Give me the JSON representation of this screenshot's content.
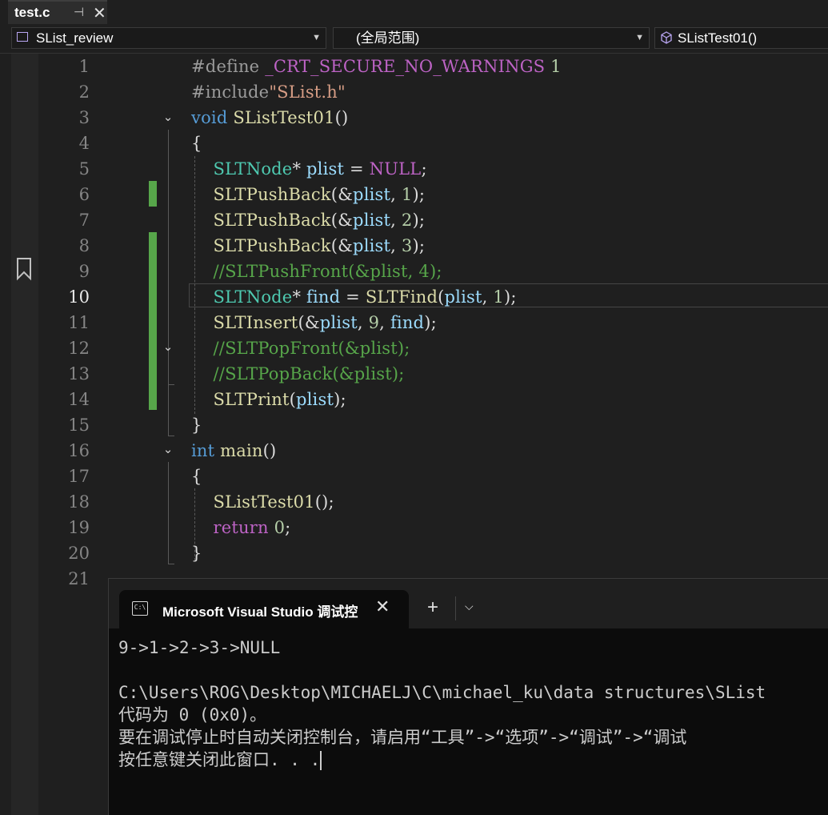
{
  "tab": {
    "title": "test.c"
  },
  "nav": {
    "project": "SList_review",
    "scope": "(全局范围)",
    "member": "SListTest01()"
  },
  "code_lines": [
    {
      "ln": "1"
    },
    {
      "ln": "2"
    },
    {
      "ln": "3"
    },
    {
      "ln": "4"
    },
    {
      "ln": "5"
    },
    {
      "ln": "6"
    },
    {
      "ln": "7"
    },
    {
      "ln": "8"
    },
    {
      "ln": "9"
    },
    {
      "ln": "10"
    },
    {
      "ln": "11"
    },
    {
      "ln": "12"
    },
    {
      "ln": "13"
    },
    {
      "ln": "14"
    },
    {
      "ln": "15"
    },
    {
      "ln": "16"
    },
    {
      "ln": "17"
    },
    {
      "ln": "18"
    },
    {
      "ln": "19"
    },
    {
      "ln": "20"
    },
    {
      "ln": "21"
    }
  ],
  "code": {
    "l1": {
      "kw": "#define",
      "name": "_CRT_SECURE_NO_WARNINGS",
      "val": "1"
    },
    "l2": {
      "kw": "#include",
      "str": "\"SList.h\""
    },
    "l3": {
      "kw": "void",
      "fn": "SListTest01",
      "rest": "()"
    },
    "l4": {
      "text": "{"
    },
    "l5": {
      "type": "SLTNode",
      "op": "*",
      "var": "plist",
      "eq": " = ",
      "val": "NULL",
      "end": ";"
    },
    "l6": {
      "fn": "SLTPushBack",
      "a": "(&",
      "var": "plist",
      "b": ", ",
      "n": "1",
      "c": ");"
    },
    "l7": {
      "fn": "SLTPushBack",
      "a": "(&",
      "var": "plist",
      "b": ", ",
      "n": "2",
      "c": ");"
    },
    "l8": {
      "fn": "SLTPushBack",
      "a": "(&",
      "var": "plist",
      "b": ", ",
      "n": "3",
      "c": ");"
    },
    "l9": {
      "comment": "//SLTPushFront(&plist, 4);"
    },
    "l10": {
      "type": "SLTNode",
      "op": "*",
      "var": "find",
      "eq": " = ",
      "fn": "SLTFind",
      "a": "(",
      "var2": "plist",
      "b": ", ",
      "n": "1",
      "c": ");"
    },
    "l11": {
      "fn": "SLTInsert",
      "a": "(&",
      "var": "plist",
      "b": ", ",
      "n": "9",
      "d": ", ",
      "var2": "find",
      "c": ");"
    },
    "l12": {
      "comment": "//SLTPopFront(&plist);"
    },
    "l13": {
      "comment": "//SLTPopBack(&plist);"
    },
    "l14": {
      "fn": "SLTPrint",
      "a": "(",
      "var": "plist",
      "c": ");"
    },
    "l15": {
      "text": "}"
    },
    "l16": {
      "kw": "int",
      "fn": "main",
      "rest": "()"
    },
    "l17": {
      "text": "{"
    },
    "l18": {
      "fn": "SListTest01",
      "rest": "();"
    },
    "l19": {
      "kw": "return",
      "n": "0",
      "end": ";"
    },
    "l20": {
      "text": "}"
    }
  },
  "console": {
    "tab_title": "Microsoft Visual Studio 调试控",
    "output": [
      "9->1->2->3->NULL",
      "",
      "C:\\Users\\ROG\\Desktop\\MICHAELJ\\C\\michael_ku\\data structures\\SList",
      "代码为 0 (0x0)。",
      "要在调试停止时自动关闭控制台，请启用“工具”->“选项”->“调试”->“调试",
      "按任意键关闭此窗口. . ."
    ]
  },
  "colors": {
    "keyword": "#569cd6",
    "type": "#4ec9b0",
    "function": "#dcdcaa",
    "variable": "#9cdcfe",
    "number": "#b5cea8",
    "string": "#d69d85",
    "comment": "#57a64a",
    "macro": "#bd63c5",
    "change_bar": "#57a64a"
  },
  "icons": [
    "pin-icon",
    "close-icon",
    "project-icon",
    "cube-icon",
    "bookmark-icon",
    "terminal-icon",
    "plus-icon",
    "chevron-down-icon"
  ]
}
